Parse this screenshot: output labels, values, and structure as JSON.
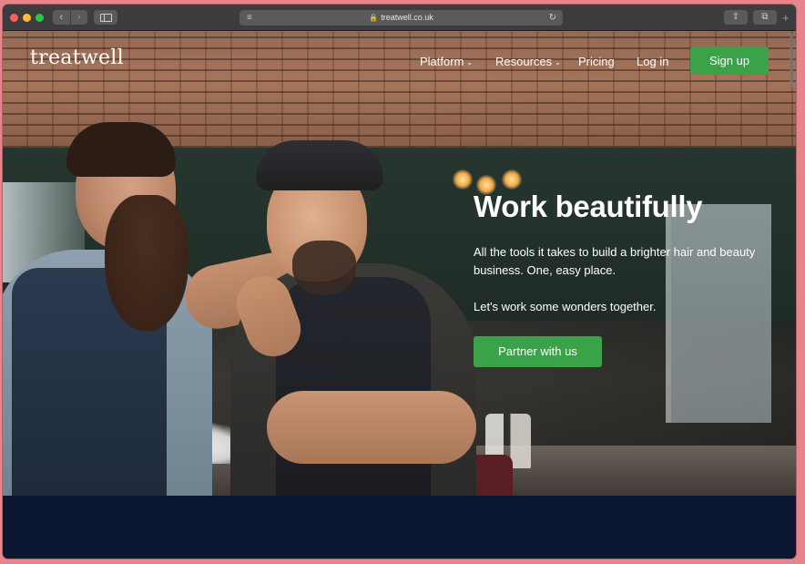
{
  "browser": {
    "url": "treatwell.co.uk",
    "back_glyph": "‹",
    "forward_glyph": "›",
    "reader_glyph": "≡",
    "lock_glyph": "🔒",
    "reload_glyph": "↻",
    "share_glyph": "⇪",
    "tabs_glyph": "⧉",
    "newtab_glyph": "+"
  },
  "site": {
    "logo": "treatwell",
    "nav": {
      "platform": "Platform",
      "resources": "Resources",
      "pricing": "Pricing",
      "login": "Log in",
      "signup": "Sign up",
      "chevron": "⌄"
    }
  },
  "hero": {
    "title": "Work beautifully",
    "body": "All the tools it takes to build a brighter hair and beauty business. One, easy place.",
    "body2": "Let's work some wonders together.",
    "cta": "Partner with us"
  },
  "colors": {
    "accent_green": "#3ba24a",
    "dark_navy": "#0b1730",
    "frame_pink": "#e8858c"
  }
}
